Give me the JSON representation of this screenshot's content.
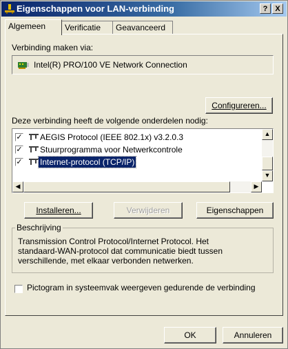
{
  "window": {
    "title": "Eigenschappen voor LAN-verbinding",
    "help_label": "?",
    "close_label": "X"
  },
  "tabs": [
    {
      "label": "Algemeen"
    },
    {
      "label": "Verificatie"
    },
    {
      "label": "Geavanceerd"
    }
  ],
  "connect_via": {
    "label": "Verbinding maken via:",
    "adapter": "Intel(R) PRO/100 VE Network Connection",
    "configure_button": "Configureren..."
  },
  "components": {
    "label": "Deze verbinding heeft de volgende onderdelen nodig:",
    "items": [
      {
        "label": "AEGIS Protocol (IEEE 802.1x) v3.2.0.3",
        "checked": true
      },
      {
        "label": "Stuurprogramma voor Netwerkcontrole",
        "checked": true
      },
      {
        "label": "Internet-protocol (TCP/IP)",
        "checked": true,
        "selected": true
      }
    ]
  },
  "buttons": {
    "install": "Installeren...",
    "remove": "Verwijderen",
    "properties": "Eigenschappen"
  },
  "description": {
    "title": "Beschrijving",
    "text_line1": "Transmission Control Protocol/Internet Protocol. Het",
    "text_line2": "standaard-WAN-protocol dat communicatie biedt tussen",
    "text_line3": "verschillende, met elkaar verbonden netwerken."
  },
  "tray_icon": {
    "label": "Pictogram in systeemvak weergeven gedurende de verbinding",
    "checked": false
  },
  "footer": {
    "ok": "OK",
    "cancel": "Annuleren"
  },
  "colors": {
    "titlebar_start": "#0a246a",
    "selection": "#0a246a",
    "face": "#ece9d8"
  }
}
